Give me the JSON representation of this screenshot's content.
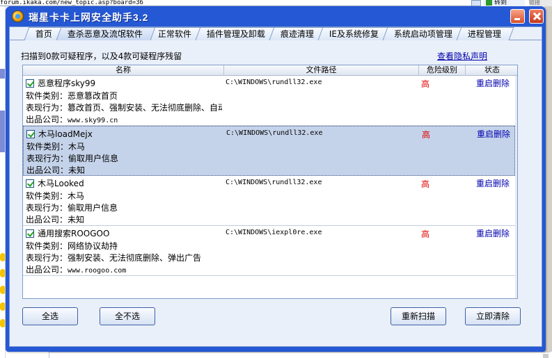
{
  "background": {
    "url_fragment": "forum.ikaka.com/new_topic.asp?board=36",
    "go_label": "转到",
    "right_fragment": "链接"
  },
  "window": {
    "title": "瑞星卡卡上网安全助手3.2",
    "controls": {
      "minimize": "minimize-icon",
      "close": "close-icon"
    }
  },
  "tabs": [
    {
      "label": "首页"
    },
    {
      "label": "查杀恶意及流氓软件"
    },
    {
      "label": "正常软件"
    },
    {
      "label": "插件管理及卸载"
    },
    {
      "label": "痕迹清理"
    },
    {
      "label": "IE及系统修复"
    },
    {
      "label": "系统启动项管理"
    },
    {
      "label": "进程管理"
    }
  ],
  "active_tab_index": 1,
  "status_text": "扫描到0款可疑程序，以及4款可疑程序残留",
  "privacy_link": "查看隐私声明",
  "list": {
    "columns": [
      "名称",
      "文件路径",
      "危险级别",
      "状态"
    ],
    "items": [
      {
        "checked": true,
        "name": "恶意程序sky99",
        "path": "C:\\WINDOWS\\rundll32.exe",
        "risk": "高",
        "action": "重启删除",
        "category_label": "软件类别：",
        "category": "恶意篡改首页",
        "behavior_label": "表现行为：",
        "behavior": "篡改首页、强制安装、无法彻底删除、自动",
        "company_label": "出品公司：",
        "company": "www.sky99.cn",
        "selected": false
      },
      {
        "checked": true,
        "name": "木马loadMejx",
        "path": "C:\\WINDOWS\\rundll32.exe",
        "risk": "高",
        "action": "重启删除",
        "category_label": "软件类别：",
        "category": "木马",
        "behavior_label": "表现行为：",
        "behavior": "偷取用户信息",
        "company_label": "出品公司：",
        "company": "未知",
        "selected": true
      },
      {
        "checked": true,
        "name": "木马Looked",
        "path": "C:\\WINDOWS\\rundll32.exe",
        "risk": "高",
        "action": "重启删除",
        "category_label": "软件类别：",
        "category": "木马",
        "behavior_label": "表现行为：",
        "behavior": "偷取用户信息",
        "company_label": "出品公司：",
        "company": "未知",
        "selected": false
      },
      {
        "checked": true,
        "name": "通用搜索ROOGOO",
        "path": "C:\\WINDOWS\\iexpl0re.exe",
        "risk": "高",
        "action": "重启删除",
        "category_label": "软件类别：",
        "category": "网络协议劫持",
        "behavior_label": "表现行为：",
        "behavior": "强制安装、无法彻底删除、弹出广告",
        "company_label": "出品公司：",
        "company": "www.roogoo.com",
        "selected": false
      }
    ]
  },
  "buttons": {
    "select_all": "全选",
    "deselect_all": "全不选",
    "rescan": "重新扫描",
    "clean_now": "立即清除"
  },
  "colors": {
    "title_bar": "#2458d4",
    "client_bg": "#eaf0fa",
    "risk_high": "#e00000",
    "action_link": "#0000b0",
    "selected_row": "#c5d3ea"
  }
}
